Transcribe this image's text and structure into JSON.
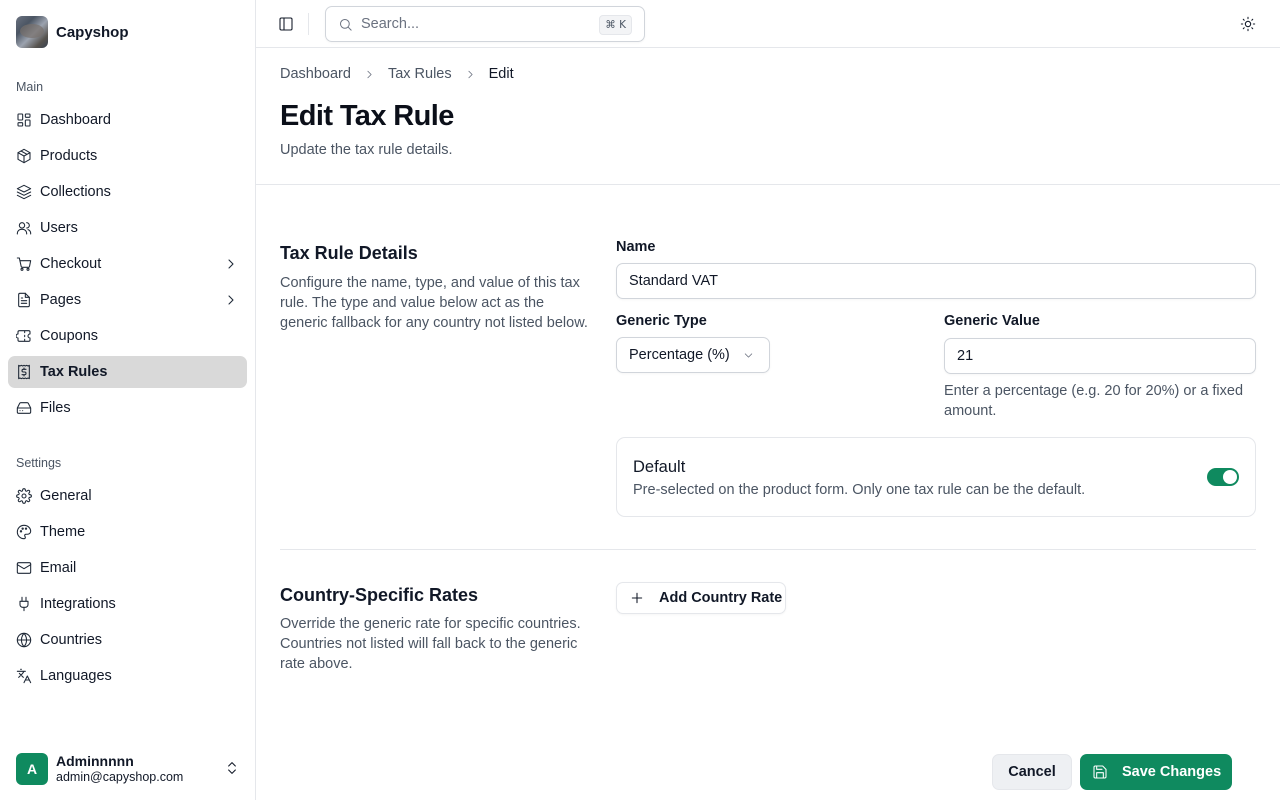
{
  "app": {
    "name": "Capyshop"
  },
  "sidebar": {
    "groups": [
      {
        "label": "Main"
      },
      {
        "label": "Settings"
      }
    ],
    "items": [
      {
        "label": "Dashboard",
        "icon": "dashboard-icon"
      },
      {
        "label": "Products",
        "icon": "package-icon"
      },
      {
        "label": "Collections",
        "icon": "layers-icon"
      },
      {
        "label": "Users",
        "icon": "users-icon"
      },
      {
        "label": "Checkout",
        "icon": "cart-icon"
      },
      {
        "label": "Pages",
        "icon": "file-text-icon"
      },
      {
        "label": "Coupons",
        "icon": "ticket-icon"
      },
      {
        "label": "Tax Rules",
        "icon": "receipt-dollar-icon",
        "active": true
      },
      {
        "label": "Files",
        "icon": "hard-drive-icon"
      },
      {
        "label": "General",
        "icon": "gear-icon"
      },
      {
        "label": "Theme",
        "icon": "palette-icon"
      },
      {
        "label": "Email",
        "icon": "mail-icon"
      },
      {
        "label": "Integrations",
        "icon": "plug-icon"
      },
      {
        "label": "Countries",
        "icon": "globe-icon"
      },
      {
        "label": "Languages",
        "icon": "languages-icon"
      }
    ]
  },
  "user": {
    "initial": "A",
    "name": "Adminnnnn",
    "email": "admin@capyshop.com"
  },
  "topbar": {
    "search_placeholder": "Search...",
    "shortcut": "⌘ K"
  },
  "breadcrumb": {
    "items": [
      "Dashboard",
      "Tax Rules",
      "Edit"
    ]
  },
  "page": {
    "title": "Edit Tax Rule",
    "subtitle": "Update the tax rule details."
  },
  "details": {
    "title": "Tax Rule Details",
    "description": "Configure the name, type, and value of this tax rule. The type and value below act as the generic fallback for any country not listed below.",
    "name_label": "Name",
    "name_value": "Standard VAT",
    "type_label": "Generic Type",
    "type_value": "Percentage (%)",
    "value_label": "Generic Value",
    "value_value": "21",
    "value_hint": "Enter a percentage (e.g. 20 for 20%) or a fixed amount.",
    "default_title": "Default",
    "default_desc": "Pre-selected on the product form. Only one tax rule can be the default.",
    "default_on": true
  },
  "country_rates": {
    "title": "Country-Specific Rates",
    "description": "Override the generic rate for specific countries. Countries not listed will fall back to the generic rate above.",
    "add_label": "Add Country Rate"
  },
  "actions": {
    "cancel_label": "Cancel",
    "save_label": "Save Changes"
  },
  "colors": {
    "accent": "#0f8a5f",
    "active_nav_bg": "#d9d9d9"
  }
}
